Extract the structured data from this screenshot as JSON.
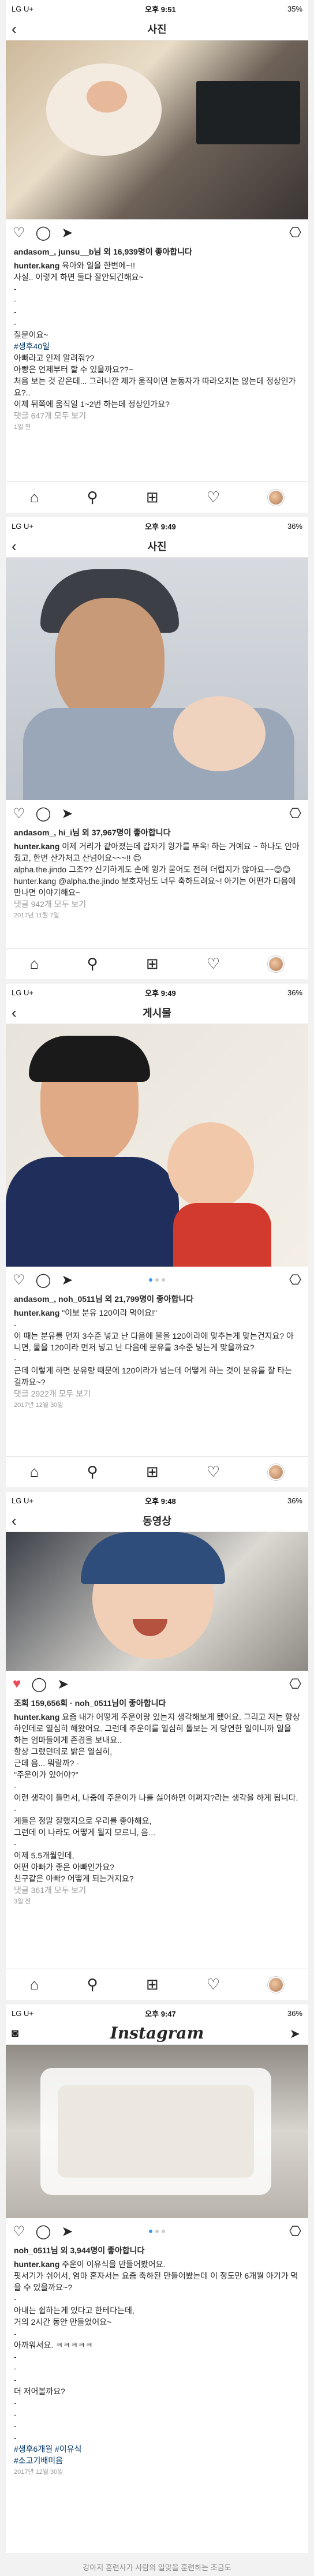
{
  "screens": [
    {
      "status": {
        "carrier": "LG U+",
        "time": "오후 9:51",
        "battery": "35%"
      },
      "title": "사진",
      "likes": "andasom_, junsu__b님 외 16,939명이 좋아합니다",
      "caption_user": "hunter.kang",
      "caption_text": "육아와 일을 한번에~!!",
      "comments": [
        "사실.. 이렇게 하면 둘다 잘안되긴해요~",
        "-",
        "-",
        "-",
        "-",
        "질문이요~",
        "#생후40일",
        "아빠라고 인제 알려줘??",
        "아빵은 언제부터 할 수 있을까요??~",
        "처음 보는 것 같은데... 그러니깐 제가 움직이면 눈동자가 따라오지는 않는데 정상인가요?..",
        "이제 뒤쪽에 움직일 1~2번 하는데 정상인가요?",
        "댓글 647개 모두 보기",
        "1일 전"
      ]
    },
    {
      "status": {
        "carrier": "LG U+",
        "time": "오후 9:49",
        "battery": "36%"
      },
      "title": "사진",
      "likes": "님 외 37,967명이 좋아합니다",
      "likes_prefix": "andasom_, hi_i",
      "caption_user": "hunter.kang",
      "caption_text": "이제 거리가 같아졌는데 갑자기 윙가를 뚜욱! 하는 거예요 ~ 하나도 안아줬고, 한번 산가처고 산넘어요~~~!! 😊",
      "comments": [
        "alpha.the.jindo 그조?? 신기하게도 손에 윙가 묻어도 전혀 더럽지가 않아요~~😊😊",
        "hunter.kang @alpha.the.jindo 보호자님도 너무 축하드려요~! 아기는 어떤가 다음에 만나면 이야기해요~",
        "댓글 942개 모두 보기",
        "2017년 11월 7일"
      ]
    },
    {
      "status": {
        "carrier": "LG U+",
        "time": "오후 9:49",
        "battery": "36%"
      },
      "title": "게시물",
      "likes": "andasom_, noh_0511님 외 21,799명이 좋아합니다",
      "caption_user": "hunter.kang",
      "caption_text": "\"이보 분유 120이라 먹어요!\"",
      "comments": [
        "-",
        "이 때는 분유를 먼저 3수준 넣고 난 다음에 물을 120이라에 맞추는게 맞는건지요? 아니면, 물을 120이라 먼저 넣고 난 다음에 분유를 3수준 넣는게 맞을까요?",
        "-",
        "근데 이렇게 하면 분유량 때문에 120이라가 넘는데 어떻게 하는 것이 분유를 잘 타는 걸까요~?",
        "댓글 2922개 모두 보기",
        "2017년 12월 30일"
      ]
    },
    {
      "status": {
        "carrier": "LG U+",
        "time": "오후 9:48",
        "battery": "36%"
      },
      "title": "동영상",
      "likes": "조회 159,656회 · noh_0511님이 좋아합니다",
      "caption_user": "hunter.kang",
      "caption_text": "요즘 내가 어떻게 주운이랑 있는지 생각해보게 됐어요. 그리고 저는 항상 하인데로 열심히 해왔어요. 그런데 주운이를 열심히 돌보는 게 당연한 일이니까 일을 하는 엄마들에게 존경을 보내요..",
      "comments": [
        "항상 그랬던데로 밝은 열심히,",
        "근데 음... 뭐랄까? - ",
        "\"주운이가 있어야?\"",
        "-",
        "이런 생각이 들면서, 나중에 주운이가 나를 싫어하면 어쩌지?라는 생각을 하게 됩니다.",
        "-",
        "게들은 정말 잘했지으로 우리를 좋아해요,",
        "그런데 이 나라도 어떻게 될지 모르니, 음...",
        "-",
        "이제 5.5개월인데,",
        "어떤 아빠가 좋은 아빠인가요?",
        "친구같은 아빠? 어떻게 되는거지요?",
        "댓글 361개 모두 보기",
        "3일 전"
      ]
    },
    {
      "status": {
        "carrier": "LG U+",
        "time": "오후 9:47",
        "battery": "36%"
      },
      "title": "Instagram",
      "likes": "noh_0511님 외 3,944명이 좋아합니다",
      "caption_user": "hunter.kang",
      "caption_text": "주운이 이유식을 만들어봤어요.",
      "comments": [
        "핏서기가 쉬어서, 엄마 혼자서는 요즘 축하된 만들어봤는데 이 정도만 6개월 아기가 먹을 수 있을까요~?",
        "-",
        "아내는 쉽하는게 있다고 한테다는데,",
        "거의 2시간 동안 만들었어요~",
        "-",
        "아까워서요. ㅋㅋㅋㅋㅋ",
        "-",
        "-",
        "-",
        "더 저어볼까요?",
        "-",
        "-",
        "-",
        "-",
        "#생후6개월 #이유식",
        "#소고기배미음",
        "2017년 12월 30일"
      ]
    }
  ],
  "footer": "강아지 훈련사가 사람의 일맞을 훈련하는 조금도"
}
